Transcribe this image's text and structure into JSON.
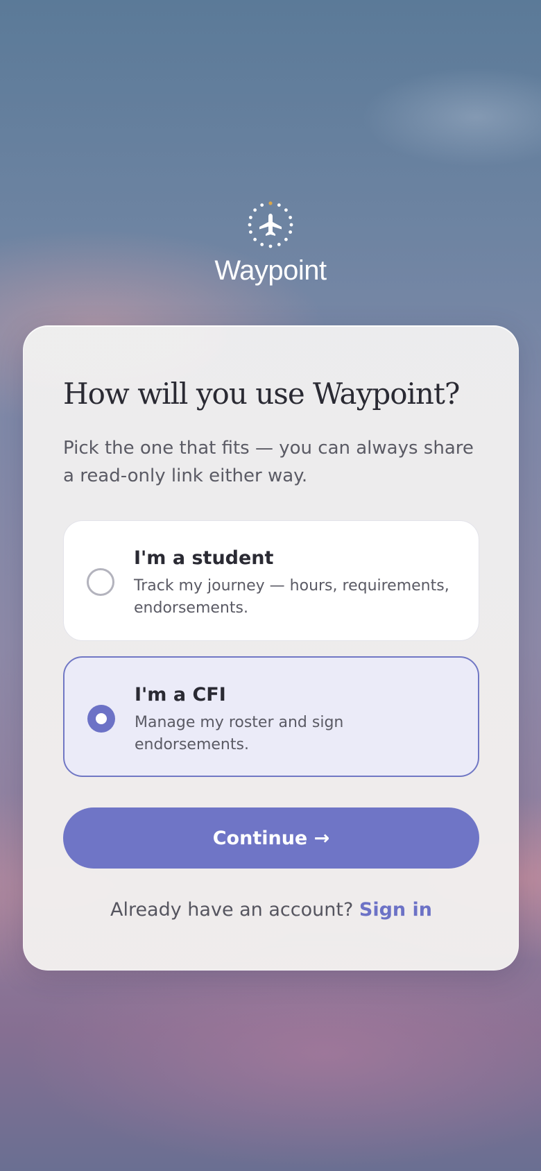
{
  "brand": {
    "name": "Waypoint",
    "icon": "airplane-compass-icon",
    "accent_dot_color": "#d9a64a"
  },
  "card": {
    "heading": "How will you use Waypoint?",
    "subtext": "Pick the one that fits — you can always share a read-only link either way.",
    "options": [
      {
        "title": "I'm a student",
        "description": "Track my journey — hours, requirements, endorsements.",
        "selected": false
      },
      {
        "title": "I'm a CFI",
        "description": "Manage my roster and sign endorsements.",
        "selected": true
      }
    ],
    "continue_label": "Continue →",
    "footer_prompt": "Already have an account?",
    "sign_in_label": "Sign in"
  },
  "colors": {
    "accent": "#6f75c6",
    "selected_bg": "#ebebf8",
    "selected_border": "#7077c4",
    "heading_text": "#2a2a33",
    "body_text": "#5a5a64"
  }
}
